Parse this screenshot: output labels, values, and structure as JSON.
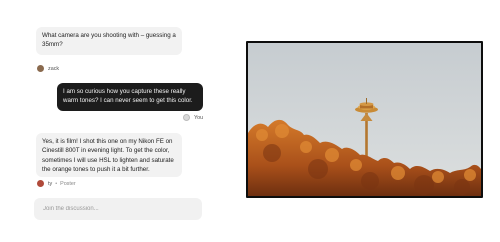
{
  "thread": {
    "messages": [
      {
        "text": "What camera are you shooting with – guessing a 35mm?",
        "author": "zack",
        "direction": "incoming"
      },
      {
        "text": "I am so curious how you capture these really warm tones? I can never seem to get this color.",
        "author": "You",
        "direction": "outgoing"
      },
      {
        "text": "Yes, it is film! I shot this one on my Nikon FE on Cinestill 800T in evening light.  To get the color, sometimes I will use HSL to lighten and saturate the orange tones to push it a bit further.",
        "author": "ty",
        "role": "Poster",
        "direction": "incoming"
      }
    ],
    "separator": "•"
  },
  "composer": {
    "placeholder": "Join the discussion..."
  },
  "photo": {
    "subject": "space-needle-autumn-film-photo"
  },
  "colors": {
    "outgoing_bubble": "#1c1c1c",
    "incoming_bubble": "#f2f2f2",
    "sky": "#cfd4d6",
    "foliage": "#c46a1f"
  }
}
